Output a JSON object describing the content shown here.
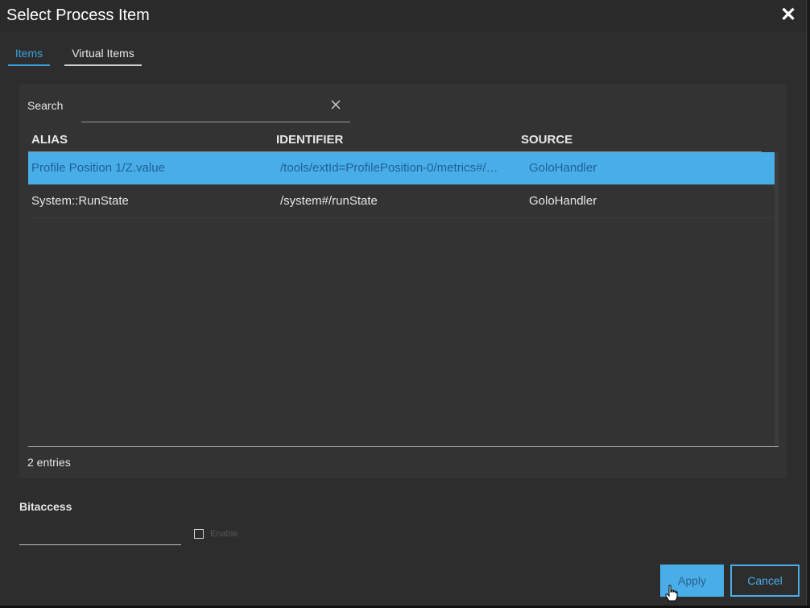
{
  "window": {
    "title": "Select Process Item"
  },
  "tabs": [
    {
      "label": "Items",
      "active": true
    },
    {
      "label": "Virtual Items",
      "active": false
    }
  ],
  "search": {
    "label": "Search",
    "value": "",
    "placeholder": ""
  },
  "table": {
    "columns": [
      "ALIAS",
      "IDENTIFIER",
      "SOURCE"
    ],
    "rows": [
      {
        "alias": "Profile Position 1/Z.value",
        "identifier": "/tools/extId=ProfilePosition-0/metrics#/…",
        "source": "GoloHandler",
        "selected": true
      },
      {
        "alias": "System::RunState",
        "identifier": "/system#/runState",
        "source": "GoloHandler",
        "selected": false
      }
    ],
    "footer": "2 entries"
  },
  "bitaccess": {
    "label": "Bitaccess",
    "value": "",
    "enable_label": "Enable",
    "enabled": false
  },
  "buttons": {
    "apply": "Apply",
    "cancel": "Cancel"
  },
  "colors": {
    "accent": "#49aee8",
    "background": "#2d2d2d",
    "panel": "#333333"
  }
}
